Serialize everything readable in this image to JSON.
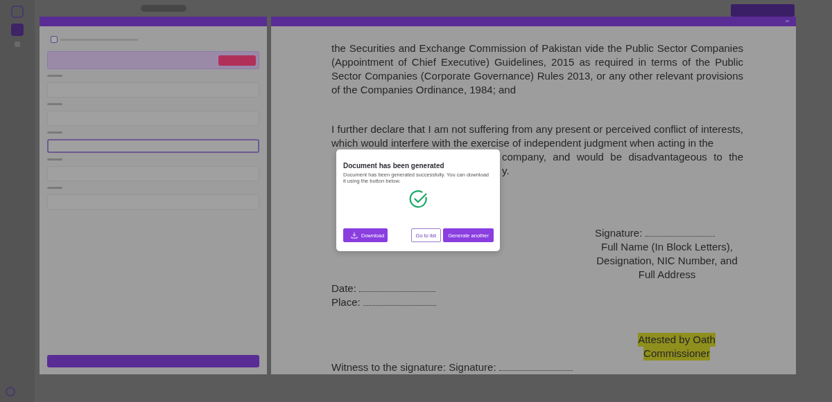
{
  "form": {
    "import_checkbox": {
      "checked": false
    }
  },
  "document": {
    "paragraphs": [
      "the Securities and Exchange Commission of Pakistan vide the Public Sector Companies (Appointment of Chief Executive) Guidelines, 2015 as required in terms of the Public Sector Companies (Corporate Governance) Rules 2013, or any other relevant provisions of the Companies Ordinance, 1984; and",
      "I further declare that I am not suffering from any present or perceived conflict of interests, which would interfere with the exercise of independent judgment when acting in the"
    ],
    "partial_lines": [
      "company, and would be disadvantageous to the",
      "y."
    ],
    "signature_lines": [
      "Signature:",
      "Full Name (In Block Letters),",
      "Designation, NIC Number, and",
      "Full Address"
    ],
    "date_label": "Date:",
    "place_label": "Place:",
    "attestation_lines": [
      "Attested by Oath",
      "Commissioner"
    ],
    "witness": "Witness to the signature: Signature:"
  },
  "dialog": {
    "title": "Document has been generated",
    "message": "Document has been generated successfully. You can download it using the button below.",
    "buttons": [
      {
        "label": "Download",
        "kind": "download"
      },
      {
        "label": "Go to list",
        "kind": "outline"
      },
      {
        "label": "Generate another",
        "kind": "primary"
      }
    ]
  }
}
